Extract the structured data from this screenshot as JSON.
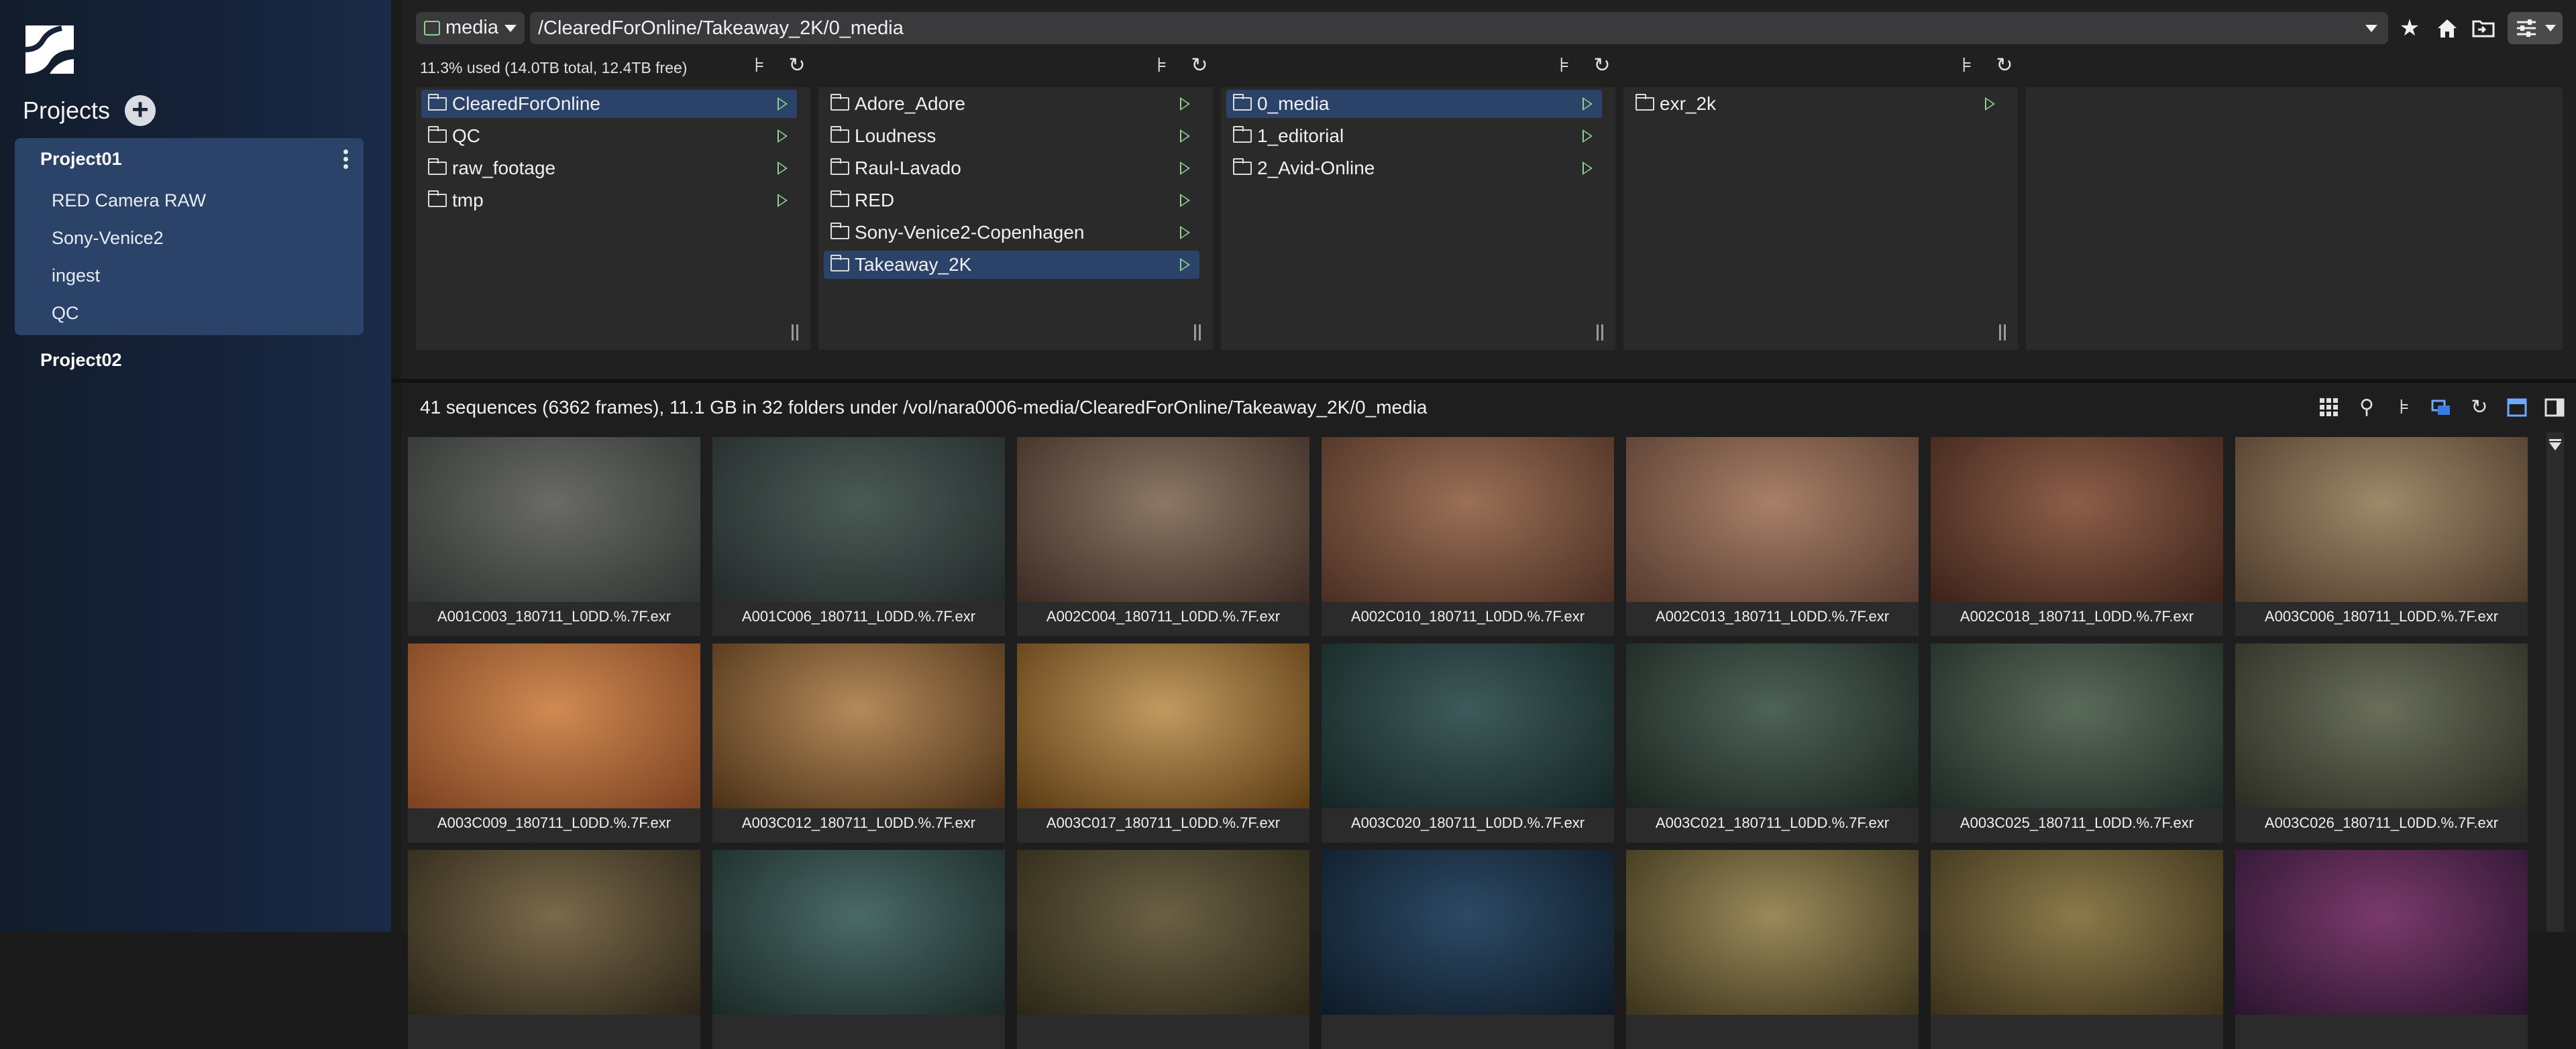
{
  "sidebar": {
    "projects_label": "Projects",
    "projects": [
      {
        "name": "Project01",
        "items": [
          "RED Camera RAW",
          "Sony-Venice2",
          "ingest",
          "QC"
        ]
      },
      {
        "name": "Project02"
      }
    ]
  },
  "toolbar": {
    "volume": "media",
    "path": "/ClearedForOnline/Takeaway_2K/0_media",
    "usage": "11.3% used (14.0TB total, 12.4TB free)"
  },
  "columns": [
    {
      "items": [
        "ClearedForOnline",
        "QC",
        "raw_footage",
        "tmp"
      ],
      "selected": "ClearedForOnline"
    },
    {
      "items": [
        "Adore_Adore",
        "Loudness",
        "Raul-Lavado",
        "RED",
        "Sony-Venice2-Copenhagen",
        "Takeaway_2K"
      ],
      "selected": "Takeaway_2K"
    },
    {
      "items": [
        "0_media",
        "1_editorial",
        "2_Avid-Online"
      ],
      "selected": "0_media"
    },
    {
      "items": [
        "exr_2k"
      ],
      "selected": ""
    },
    {
      "items": [],
      "selected": ""
    }
  ],
  "gallery": {
    "summary": "41 sequences (6362 frames), 11.1 GB in 32 folders under /vol/nara0006-media/ClearedForOnline/Takeaway_2K/0_media",
    "tiles": [
      {
        "caption": "A001C003_180711_L0DD.%.7F.exr",
        "c1": "#6a6a66",
        "c2": "#2e3432"
      },
      {
        "caption": "A001C006_180711_L0DD.%.7F.exr",
        "c1": "#4a5a55",
        "c2": "#232a29"
      },
      {
        "caption": "A002C004_180711_L0DD.%.7F.exr",
        "c1": "#8a7766",
        "c2": "#3a2a22"
      },
      {
        "caption": "A002C010_180711_L0DD.%.7F.exr",
        "c1": "#9a7056",
        "c2": "#4a2e22"
      },
      {
        "caption": "A002C013_180711_L0DD.%.7F.exr",
        "c1": "#a88068",
        "c2": "#553a2e"
      },
      {
        "caption": "A002C018_180711_L0DD.%.7F.exr",
        "c1": "#8c5e48",
        "c2": "#3c221a"
      },
      {
        "caption": "A003C006_180711_L0DD.%.7F.exr",
        "c1": "#9c8a6a",
        "c2": "#4c3a2a"
      },
      {
        "caption": "A003C009_180711_L0DD.%.7F.exr",
        "c1": "#d08a52",
        "c2": "#7a4020"
      },
      {
        "caption": "A003C012_180711_L0DD.%.7F.exr",
        "c1": "#b48a5a",
        "c2": "#4a3016"
      },
      {
        "caption": "A003C017_180711_L0DD.%.7F.exr",
        "c1": "#c09a60",
        "c2": "#5a3a12"
      },
      {
        "caption": "A003C020_180711_L0DD.%.7F.exr",
        "c1": "#3e5a5a",
        "c2": "#152424"
      },
      {
        "caption": "A003C021_180711_L0DD.%.7F.exr",
        "c1": "#4e6256",
        "c2": "#1a2420"
      },
      {
        "caption": "A003C025_180711_L0DD.%.7F.exr",
        "c1": "#5a6a5a",
        "c2": "#1e2a24"
      },
      {
        "caption": "A003C026_180711_L0DD.%.7F.exr",
        "c1": "#6a6e5a",
        "c2": "#2a2c22"
      },
      {
        "caption": "",
        "c1": "#7a6a4a",
        "c2": "#2a2418"
      },
      {
        "caption": "",
        "c1": "#4a6a66",
        "c2": "#1a2826"
      },
      {
        "caption": "",
        "c1": "#6a6044",
        "c2": "#2a2616"
      },
      {
        "caption": "",
        "c1": "#2c4a66",
        "c2": "#0e1a26"
      },
      {
        "caption": "",
        "c1": "#9a8a5a",
        "c2": "#3a321a"
      },
      {
        "caption": "",
        "c1": "#8a7a4a",
        "c2": "#3a301a"
      },
      {
        "caption": "",
        "c1": "#7a3a6a",
        "c2": "#2a1430"
      }
    ]
  },
  "colors": {
    "accent": "#2b4368",
    "play": "#8fd18f",
    "sidebar": "#15223a"
  }
}
